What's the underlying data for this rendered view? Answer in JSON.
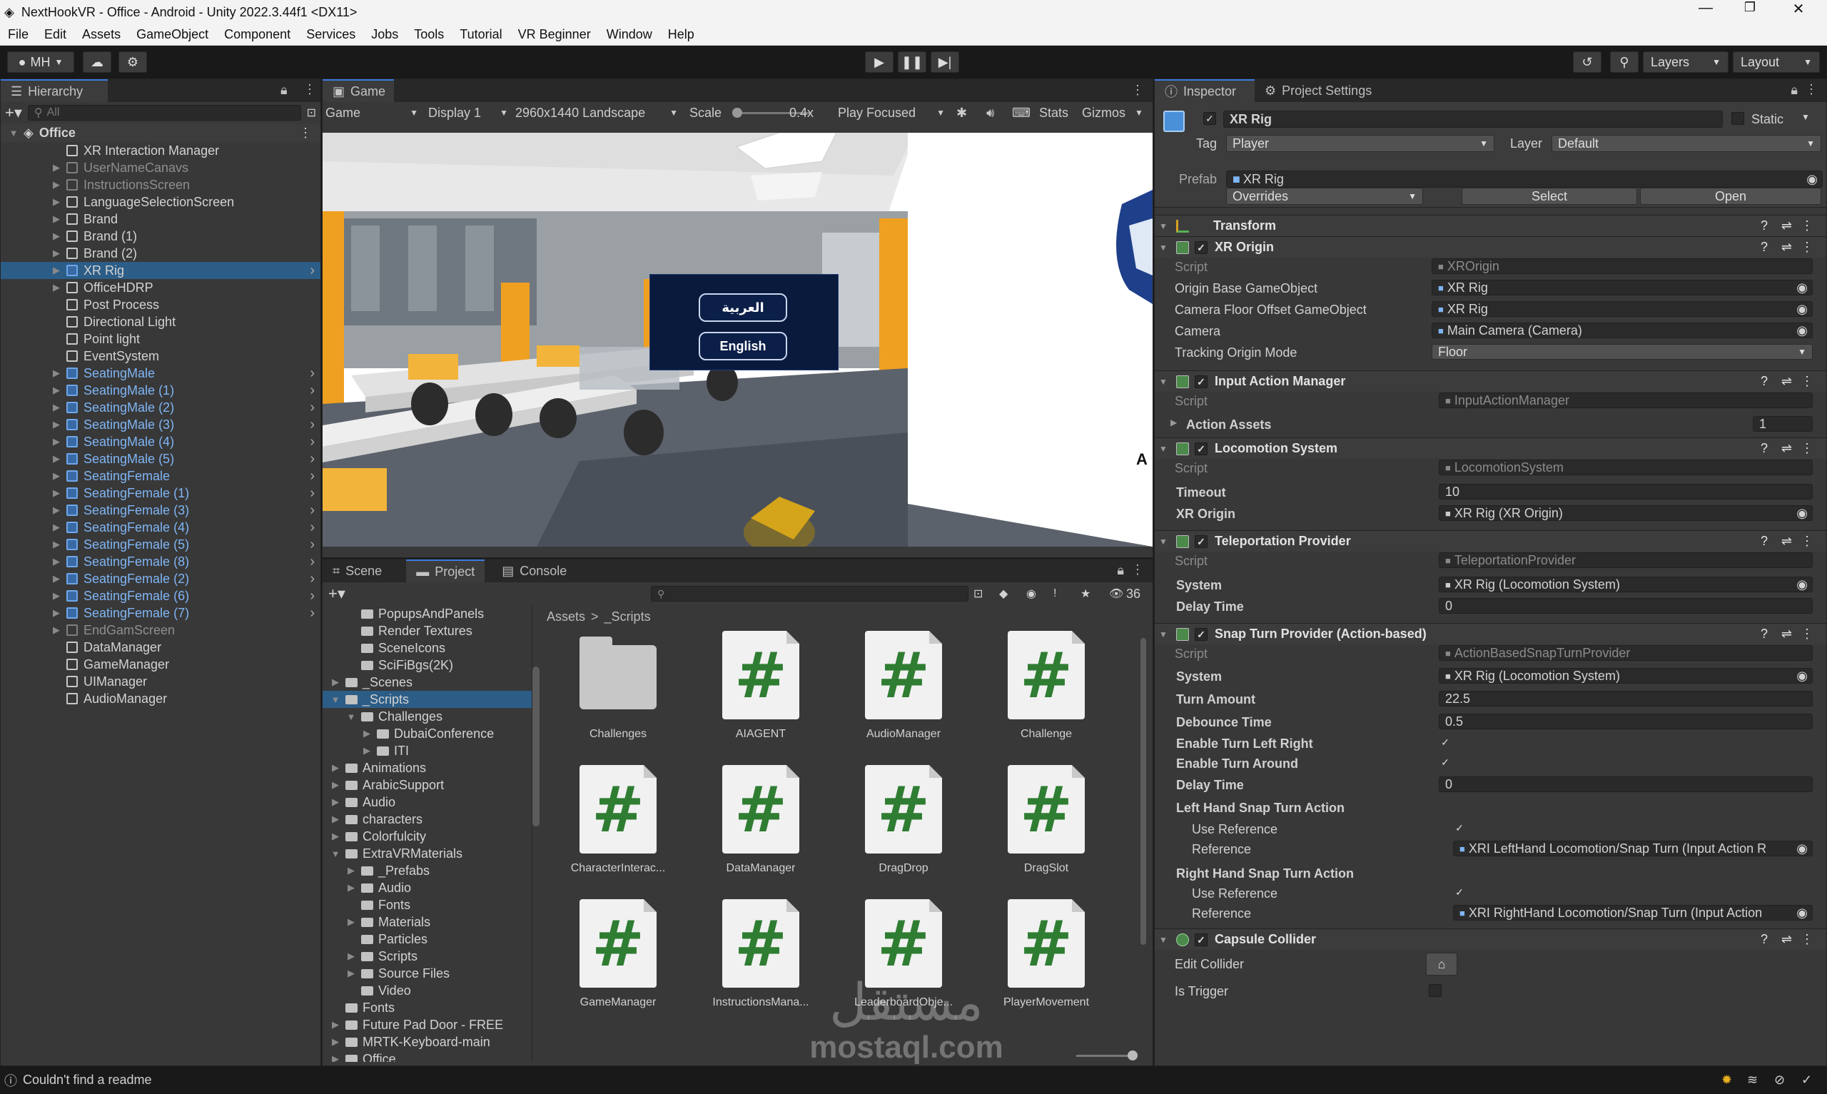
{
  "window": {
    "title": "NextHookVR - Office - Android - Unity 2022.3.44f1 <DX11>"
  },
  "menu": [
    "File",
    "Edit",
    "Assets",
    "GameObject",
    "Component",
    "Services",
    "Jobs",
    "Tools",
    "Tutorial",
    "VR Beginner",
    "Window",
    "Help"
  ],
  "toolbar": {
    "account": "MH",
    "layers": "Layers",
    "layout": "Layout"
  },
  "hierarchy": {
    "tab": "Hierarchy",
    "search_placeholder": "All",
    "scene": "Office",
    "items": [
      {
        "label": "XR Interaction Manager",
        "style": "normal",
        "arrow": false
      },
      {
        "label": "UserNameCanavs",
        "style": "dim",
        "arrow": true
      },
      {
        "label": "InstructionsScreen",
        "style": "dim",
        "arrow": true
      },
      {
        "label": "LanguageSelectionScreen",
        "style": "normal",
        "arrow": true
      },
      {
        "label": "Brand",
        "style": "normal",
        "arrow": true
      },
      {
        "label": "Brand (1)",
        "style": "normal",
        "arrow": true
      },
      {
        "label": "Brand (2)",
        "style": "normal",
        "arrow": true
      },
      {
        "label": "XR Rig",
        "style": "selected",
        "arrow": true
      },
      {
        "label": "OfficeHDRP",
        "style": "normal",
        "arrow": true
      },
      {
        "label": "Post Process",
        "style": "normal",
        "arrow": false
      },
      {
        "label": "Directional Light",
        "style": "normal",
        "arrow": false
      },
      {
        "label": "Point light",
        "style": "normal",
        "arrow": false
      },
      {
        "label": "EventSystem",
        "style": "normal",
        "arrow": false
      },
      {
        "label": "SeatingMale",
        "style": "prefab",
        "arrow": true
      },
      {
        "label": "SeatingMale (1)",
        "style": "prefab",
        "arrow": true
      },
      {
        "label": "SeatingMale (2)",
        "style": "prefab",
        "arrow": true
      },
      {
        "label": "SeatingMale (3)",
        "style": "prefab",
        "arrow": true
      },
      {
        "label": "SeatingMale (4)",
        "style": "prefab",
        "arrow": true
      },
      {
        "label": "SeatingMale (5)",
        "style": "prefab",
        "arrow": true
      },
      {
        "label": "SeatingFemale",
        "style": "prefab",
        "arrow": true
      },
      {
        "label": "SeatingFemale (1)",
        "style": "prefab",
        "arrow": true
      },
      {
        "label": "SeatingFemale (3)",
        "style": "prefab",
        "arrow": true
      },
      {
        "label": "SeatingFemale (4)",
        "style": "prefab",
        "arrow": true
      },
      {
        "label": "SeatingFemale (5)",
        "style": "prefab",
        "arrow": true
      },
      {
        "label": "SeatingFemale (8)",
        "style": "prefab",
        "arrow": true
      },
      {
        "label": "SeatingFemale (2)",
        "style": "prefab",
        "arrow": true
      },
      {
        "label": "SeatingFemale (6)",
        "style": "prefab",
        "arrow": true
      },
      {
        "label": "SeatingFemale (7)",
        "style": "prefab",
        "arrow": true
      },
      {
        "label": "EndGamScreen",
        "style": "dim",
        "arrow": true
      },
      {
        "label": "DataManager",
        "style": "normal",
        "arrow": false
      },
      {
        "label": "GameManager",
        "style": "normal",
        "arrow": false
      },
      {
        "label": "UIManager",
        "style": "normal",
        "arrow": false
      },
      {
        "label": "AudioManager",
        "style": "normal",
        "arrow": false
      }
    ]
  },
  "game": {
    "tab": "Game",
    "mode": "Game",
    "display": "Display 1",
    "resolution": "2960x1440 Landscape",
    "scale_label": "Scale",
    "scale_value": "0.4x",
    "play_mode": "Play Focused",
    "stats": "Stats",
    "gizmos": "Gizmos",
    "lang_arabic": "العربية",
    "lang_english": "English",
    "edge_letter": "A"
  },
  "project": {
    "tabs": [
      "Scene",
      "Project",
      "Console"
    ],
    "count": "36",
    "breadcrumb_root": "Assets",
    "breadcrumb_sep": ">",
    "breadcrumb_leaf": "_Scripts",
    "tree": [
      {
        "label": "PopupsAndPanels",
        "indent": 2,
        "arrow": ""
      },
      {
        "label": "Render Textures",
        "indent": 2,
        "arrow": ""
      },
      {
        "label": "SceneIcons",
        "indent": 2,
        "arrow": ""
      },
      {
        "label": "SciFiBgs(2K)",
        "indent": 2,
        "arrow": ""
      },
      {
        "label": "_Scenes",
        "indent": 1,
        "arrow": "▶"
      },
      {
        "label": "_Scripts",
        "indent": 1,
        "arrow": "▼",
        "selected": true
      },
      {
        "label": "Challenges",
        "indent": 2,
        "arrow": "▼"
      },
      {
        "label": "DubaiConference",
        "indent": 3,
        "arrow": "▶"
      },
      {
        "label": "ITI",
        "indent": 3,
        "arrow": "▶"
      },
      {
        "label": "Animations",
        "indent": 1,
        "arrow": "▶"
      },
      {
        "label": "ArabicSupport",
        "indent": 1,
        "arrow": "▶"
      },
      {
        "label": "Audio",
        "indent": 1,
        "arrow": "▶"
      },
      {
        "label": "characters",
        "indent": 1,
        "arrow": "▶"
      },
      {
        "label": "Colorfulcity",
        "indent": 1,
        "arrow": "▶"
      },
      {
        "label": "ExtraVRMaterials",
        "indent": 1,
        "arrow": "▼"
      },
      {
        "label": "_Prefabs",
        "indent": 2,
        "arrow": "▶"
      },
      {
        "label": "Audio",
        "indent": 2,
        "arrow": "▶"
      },
      {
        "label": "Fonts",
        "indent": 2,
        "arrow": ""
      },
      {
        "label": "Materials",
        "indent": 2,
        "arrow": "▶"
      },
      {
        "label": "Particles",
        "indent": 2,
        "arrow": ""
      },
      {
        "label": "Scripts",
        "indent": 2,
        "arrow": "▶"
      },
      {
        "label": "Source Files",
        "indent": 2,
        "arrow": "▶"
      },
      {
        "label": "Video",
        "indent": 2,
        "arrow": ""
      },
      {
        "label": "Fonts",
        "indent": 1,
        "arrow": ""
      },
      {
        "label": "Future Pad Door - FREE",
        "indent": 1,
        "arrow": "▶"
      },
      {
        "label": "MRTK-Keyboard-main",
        "indent": 1,
        "arrow": "▶"
      },
      {
        "label": "Office",
        "indent": 1,
        "arrow": "▶"
      }
    ],
    "assets": [
      {
        "name": "Challenges",
        "type": "folder"
      },
      {
        "name": "AIAGENT",
        "type": "script"
      },
      {
        "name": "AudioManager",
        "type": "script"
      },
      {
        "name": "Challenge",
        "type": "script"
      },
      {
        "name": "CharacterInterac...",
        "type": "script"
      },
      {
        "name": "DataManager",
        "type": "script"
      },
      {
        "name": "DragDrop",
        "type": "script"
      },
      {
        "name": "DragSlot",
        "type": "script"
      },
      {
        "name": "GameManager",
        "type": "script"
      },
      {
        "name": "InstructionsMana...",
        "type": "script"
      },
      {
        "name": "LeaderboardObje...",
        "type": "script"
      },
      {
        "name": "PlayerMovement",
        "type": "script"
      }
    ]
  },
  "inspector": {
    "tabs": [
      "Inspector",
      "Project Settings"
    ],
    "object_name": "XR Rig",
    "static_label": "Static",
    "tag_label": "Tag",
    "tag_value": "Player",
    "layer_label": "Layer",
    "layer_value": "Default",
    "prefab_label": "Prefab",
    "prefab_value": "XR Rig",
    "overrides": "Overrides",
    "select": "Select",
    "open": "Open",
    "components": {
      "transform": "Transform",
      "xr_origin": {
        "title": "XR Origin",
        "script_label": "Script",
        "script_value": "XROrigin",
        "origin_label": "Origin Base GameObject",
        "origin_value": "XR Rig",
        "cam_offset_label": "Camera Floor Offset GameObject",
        "cam_offset_value": "XR Rig",
        "camera_label": "Camera",
        "camera_value": "Main Camera (Camera)",
        "tracking_label": "Tracking Origin Mode",
        "tracking_value": "Floor"
      },
      "input_action_manager": {
        "title": "Input Action Manager",
        "script_label": "Script",
        "script_value": "InputActionManager",
        "assets_label": "Action Assets",
        "assets_count": "1"
      },
      "locomotion_system": {
        "title": "Locomotion System",
        "script_label": "Script",
        "script_value": "LocomotionSystem",
        "timeout_label": "Timeout",
        "timeout_value": "10",
        "origin_label": "XR Origin",
        "origin_value": "XR Rig (XR Origin)"
      },
      "teleportation_provider": {
        "title": "Teleportation Provider",
        "script_label": "Script",
        "script_value": "TeleportationProvider",
        "system_label": "System",
        "system_value": "XR Rig (Locomotion System)",
        "delay_label": "Delay Time",
        "delay_value": "0"
      },
      "snap_turn": {
        "title": "Snap Turn Provider (Action-based)",
        "script_label": "Script",
        "script_value": "ActionBasedSnapTurnProvider",
        "system_label": "System",
        "system_value": "XR Rig (Locomotion System)",
        "turn_amount_label": "Turn Amount",
        "turn_amount_value": "22.5",
        "debounce_label": "Debounce Time",
        "debounce_value": "0.5",
        "enable_lr_label": "Enable Turn Left Right",
        "enable_around_label": "Enable Turn Around",
        "delay_label": "Delay Time",
        "delay_value": "0",
        "left_label": "Left Hand Snap Turn Action",
        "right_label": "Right Hand Snap Turn Action",
        "use_ref_label": "Use Reference",
        "reference_label": "Reference",
        "left_ref_value": "XRI LeftHand Locomotion/Snap Turn (Input Action R",
        "right_ref_value": "XRI RightHand Locomotion/Snap Turn (Input Action"
      },
      "capsule_collider": {
        "title": "Capsule Collider",
        "edit_label": "Edit Collider",
        "trigger_label": "Is Trigger"
      }
    }
  },
  "status": {
    "message": "Couldn't find a readme"
  },
  "watermark": {
    "arabic": "مستقل",
    "latin": "mostaql.com"
  },
  "colors": {
    "accent": "#3a7ae0",
    "selection": "#2c5d87",
    "script_hash": "#2f7d32",
    "prefab": "#7fb5f5"
  }
}
